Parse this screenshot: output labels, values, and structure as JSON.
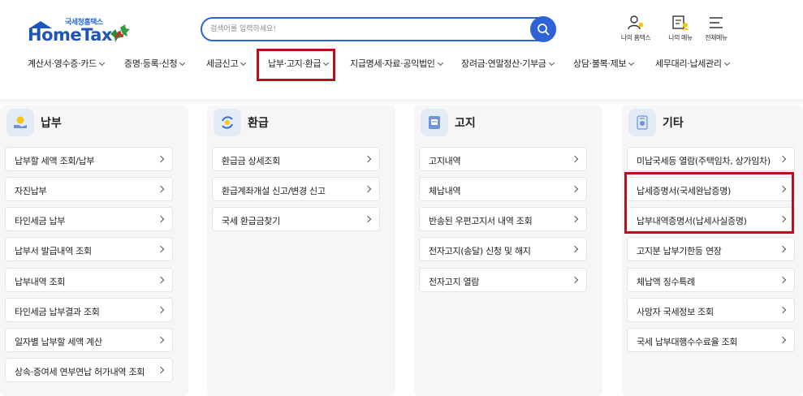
{
  "header": {
    "logo_small": "국세청홈택스",
    "logo_main": "HomeTax",
    "search_placeholder": "검색어를 입력하세요!",
    "util": [
      {
        "label": "나의 홈택스",
        "icon": "person-bell-icon"
      },
      {
        "label": "나의 메뉴",
        "icon": "my-menu-icon"
      },
      {
        "label": "전체메뉴",
        "icon": "hamburger-icon"
      }
    ],
    "nav": [
      "계산서·영수증·카드",
      "증명·등록·신청",
      "세금신고",
      "납부·고지·환급",
      "지급명세·자료·공익법인",
      "장려금·연말정산·기부금",
      "상담·불복·제보",
      "세무대리·납세관리"
    ]
  },
  "columns": [
    {
      "title": "납부",
      "icon": "payment-coin-icon",
      "items": [
        "납부할 세액 조회/납부",
        "자진납부",
        "타인세금 납부",
        "납부서 발급내역 조회",
        "납부내역 조회",
        "타인세금 납부결과 조회",
        "일자별 납부할 세액 계산",
        "상속·증여세 연부연납 허가내역 조회"
      ]
    },
    {
      "title": "환급",
      "icon": "refund-exchange-icon",
      "items": [
        "환급금 상세조회",
        "환급계좌개설 신고/변경 신고",
        "국세 환급금찾기"
      ]
    },
    {
      "title": "고지",
      "icon": "notice-document-icon",
      "items": [
        "고지내역",
        "체납내역",
        "반송된 우편고지서 내역 조회",
        "전자고지(송달) 신청 및 해지",
        "전자고지 열람"
      ]
    },
    {
      "title": "기타",
      "icon": "etc-device-icon",
      "items": [
        "미납국세등 열람(주택임차, 상가임차)",
        "납세증명서(국세완납증명)",
        "납부내역증명서(납세사실증명)",
        "고지분 납부기한등 연장",
        "체납액 징수특례",
        "사망자 국세정보 조회",
        "국세 납부대행수수료율 조회"
      ]
    }
  ],
  "colors": {
    "brand_blue": "#2e63d8",
    "highlight_red": "#b3121e",
    "panel_bg": "#f6f6f7"
  }
}
